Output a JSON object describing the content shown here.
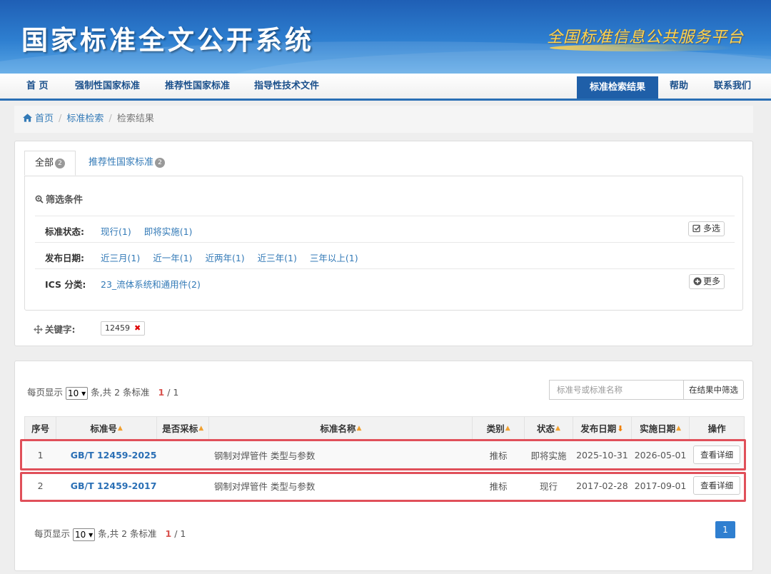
{
  "header": {
    "site_title": "国家标准全文公开系统",
    "platform_title": "全国标准信息公共服务平台"
  },
  "nav": {
    "home": "首 页",
    "mandatory": "强制性国家标准",
    "recommended": "推荐性国家标准",
    "guidance": "指导性技术文件",
    "search_result": "标准检索结果",
    "help": "帮助",
    "contact": "联系我们"
  },
  "breadcrumb": {
    "home": "首页",
    "search": "标准检索",
    "current": "检索结果"
  },
  "tabs": [
    {
      "label": "全部",
      "count": "2"
    },
    {
      "label": "推荐性国家标准",
      "count": "2"
    }
  ],
  "filters": {
    "title": "筛选条件",
    "status": {
      "label": "标准状态:",
      "options": [
        "现行(1)",
        "即将实施(1)"
      ],
      "button": "多选"
    },
    "date": {
      "label": "发布日期:",
      "options": [
        "近三月(1)",
        "近一年(1)",
        "近两年(1)",
        "近三年(1)",
        "三年以上(1)"
      ]
    },
    "ics": {
      "label": "ICS 分类:",
      "options": [
        "23_流体系统和通用件(2)"
      ],
      "button": "更多"
    }
  },
  "keyword": {
    "label": "关键字:",
    "value": "12459"
  },
  "results": {
    "perpage_prefix": "每页显示",
    "perpage_value": "10",
    "perpage_suffix": "条,共",
    "total": "2",
    "total_suffix": "条标准",
    "page_current": "1",
    "page_total": " / 1",
    "search_placeholder": "标准号或标准名称",
    "search_button": "在结果中筛选",
    "columns": [
      "序号",
      "标准号",
      "是否采标",
      "标准名称",
      "类别",
      "状态",
      "发布日期",
      "实施日期",
      "操作"
    ],
    "rows": [
      {
        "index": "1",
        "code": "GB/T 12459-2025",
        "adopted": "",
        "name": "钢制对焊管件 类型与参数",
        "category": "推标",
        "status": "即将实施",
        "publish": "2025-10-31",
        "implement": "2026-05-01",
        "action": "查看详细"
      },
      {
        "index": "2",
        "code": "GB/T 12459-2017",
        "adopted": "",
        "name": "钢制对焊管件 类型与参数",
        "category": "推标",
        "status": "现行",
        "publish": "2017-02-28",
        "implement": "2017-09-01",
        "action": "查看详细"
      }
    ],
    "pager_page": "1"
  },
  "colors": {
    "brand_blue": "#1f5fa8",
    "link": "#337ab7",
    "highlight": "#e0505a"
  }
}
